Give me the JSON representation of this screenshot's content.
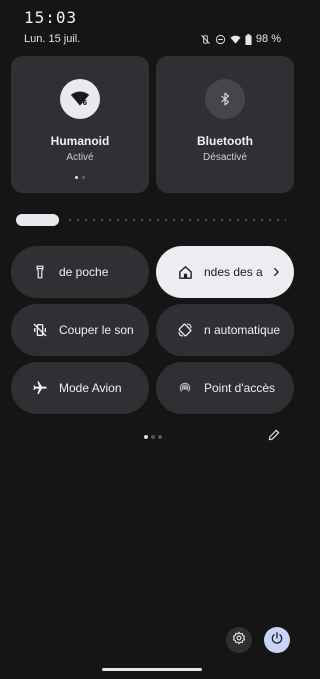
{
  "status_bar": {
    "time": "15:03",
    "date": "Lun. 15 juil.",
    "battery": "98 %",
    "icons": [
      "vibrate-off-icon",
      "do-not-disturb-icon",
      "wifi-icon",
      "battery-icon"
    ]
  },
  "tiles": {
    "wifi": {
      "title": "Humanoid",
      "subtitle": "Activé",
      "icon": "wifi-6-icon"
    },
    "bluetooth": {
      "title": "Bluetooth",
      "subtitle": "Désactivé",
      "icon": "bluetooth-icon"
    }
  },
  "brightness": {
    "level": 0.1
  },
  "quick_tiles": [
    {
      "label": "de poche",
      "icon": "flashlight-icon",
      "active": false
    },
    {
      "label": "ndes des a",
      "icon": "home-icon",
      "active": true
    },
    {
      "label": "Couper le son",
      "icon": "mute-icon",
      "active": false
    },
    {
      "label": "n automatique",
      "icon": "auto-rotate-icon",
      "active": false
    },
    {
      "label": "Mode Avion",
      "icon": "airplane-icon",
      "active": false
    },
    {
      "label": "Point d'accès",
      "icon": "hotspot-icon",
      "active": false
    }
  ],
  "colors": {
    "background": "#151515",
    "tile": "#2f3033",
    "tile_active": "#eeecf2",
    "power": "#c8d3f7"
  }
}
